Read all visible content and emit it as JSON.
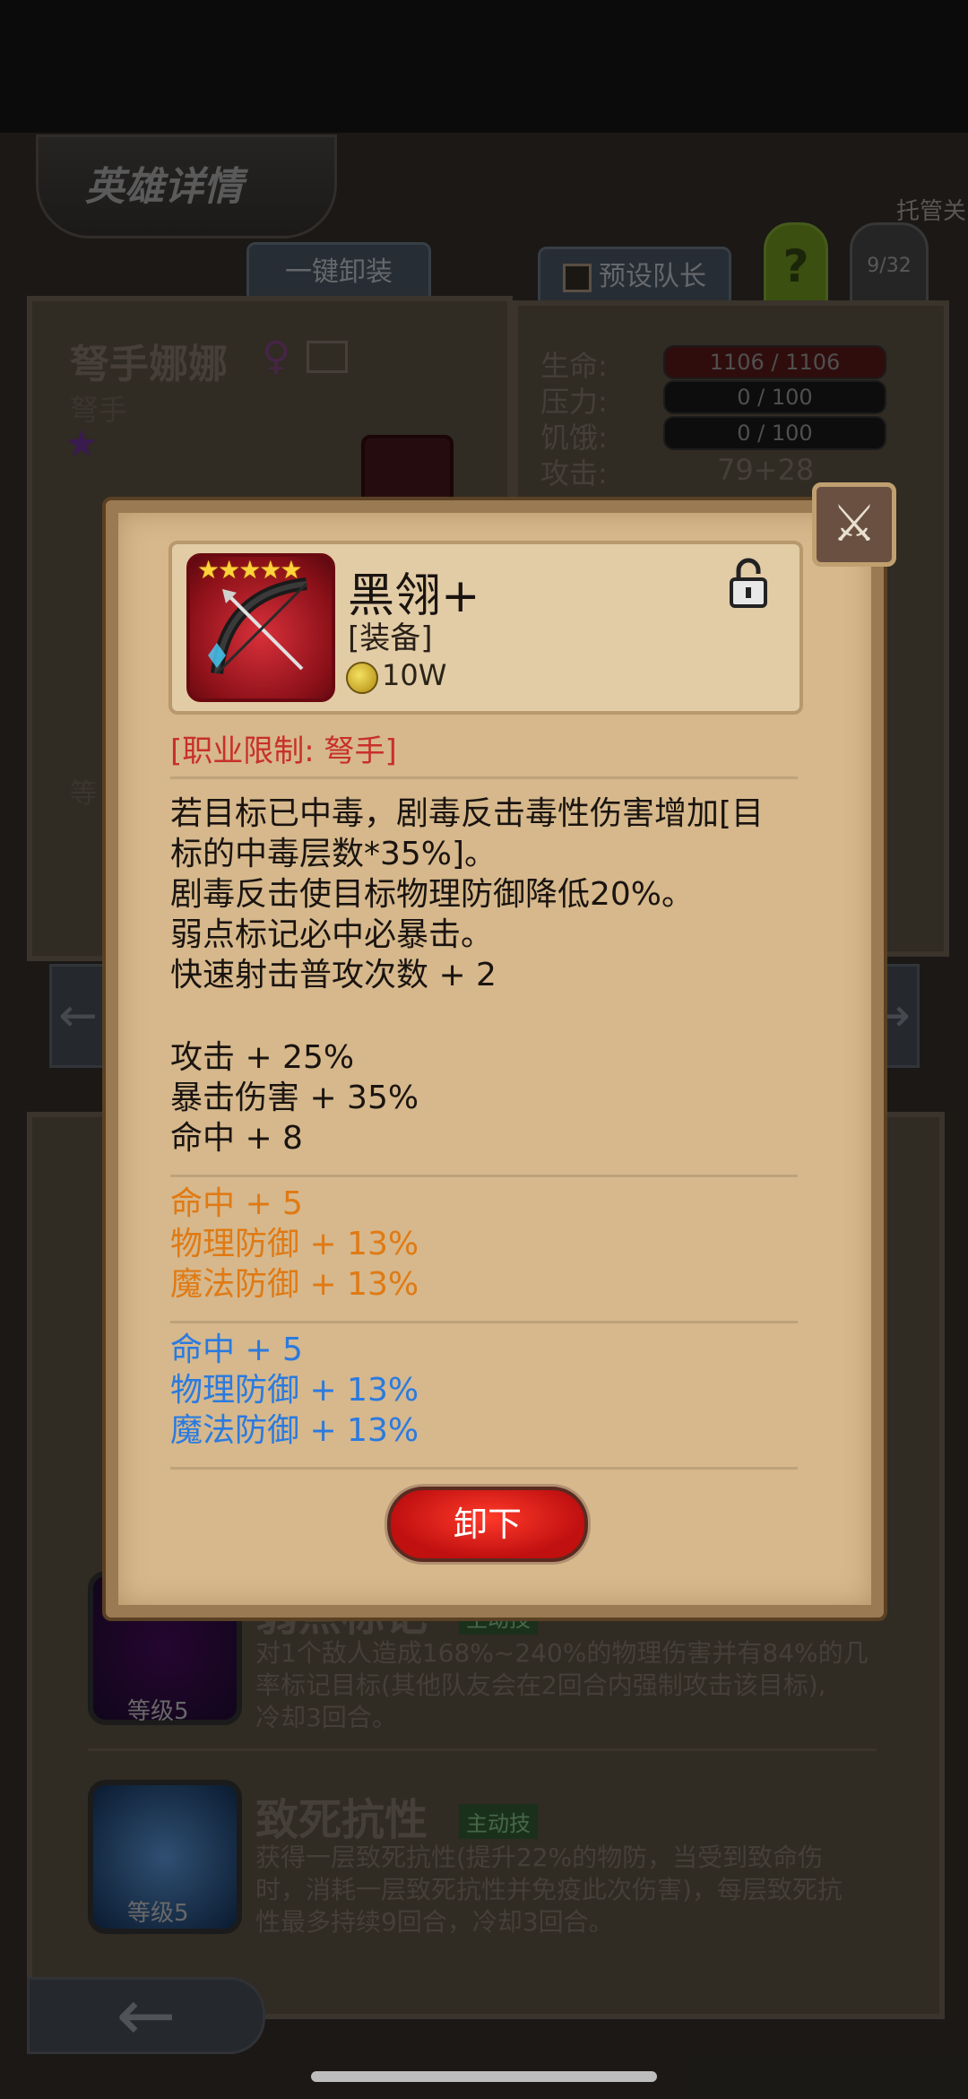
{
  "background": {
    "title": "英雄详情",
    "auto_close": "托管关",
    "unequip_all": "一键卸装",
    "preset_leader": "预设队长",
    "help": "?",
    "page_count": "9/32",
    "hero": {
      "name": "弩手娜娜",
      "gender_symbol": "♀",
      "class": "弩手",
      "side_label": "等"
    },
    "stats": [
      {
        "label": "生命:",
        "value": "1106 / 1106"
      },
      {
        "label": "压力:",
        "value": "0 / 100"
      },
      {
        "label": "饥饿:",
        "value": "0 / 100"
      },
      {
        "label": "攻击:",
        "value": "79+28"
      }
    ],
    "skills": [
      {
        "name": "弱点标记",
        "tag": "主动技",
        "level": "等级5",
        "desc": [
          "对1个敌人造成168%~240%的物理伤害并有84%的几",
          "率标记目标(其他队友会在2回合内强制攻击该目标),",
          "冷却3回合。"
        ]
      },
      {
        "name": "致死抗性",
        "tag": "主动技",
        "level": "等级5",
        "desc": [
          "获得一层致死抗性(提升22%的物防，当受到致命伤",
          "时，消耗一层致死抗性并免疫此次伤害)，每层致死抗",
          "性最多持续9回合，冷却3回合。"
        ]
      }
    ]
  },
  "modal": {
    "item": {
      "stars": "★★★★★",
      "name": "黑翎+",
      "type": "[装备]",
      "price": "10W"
    },
    "class_limit": "[职业限制: 弩手]",
    "effects": [
      "若目标已中毒，剧毒反击毒性伤害增加[目",
      "标的中毒层数*35%]。",
      "剧毒反击使目标物理防御降低20%。",
      "弱点标记必中必暴击。",
      "快速射击普攻次数 + 2"
    ],
    "base_stats": [
      "攻击 + 25%",
      "暴击伤害 + 35%",
      "命中 + 8"
    ],
    "orange_stats": [
      "命中 + 5",
      "物理防御 + 13%",
      "魔法防御 + 13%"
    ],
    "blue_stats": [
      "命中 + 5",
      "物理防御 + 13%",
      "魔法防御 + 13%"
    ],
    "unequip_label": "卸下"
  },
  "colors": {
    "class_limit": "#c8302a",
    "orange_affix": "#e07a14",
    "blue_affix": "#2a7ae0",
    "unequip_button": "#e02a1a"
  },
  "icons": {
    "close": "crossed-swords-icon",
    "lock": "padlock-icon",
    "coin": "gold-coin-icon",
    "item": "black-crossbow-icon"
  }
}
